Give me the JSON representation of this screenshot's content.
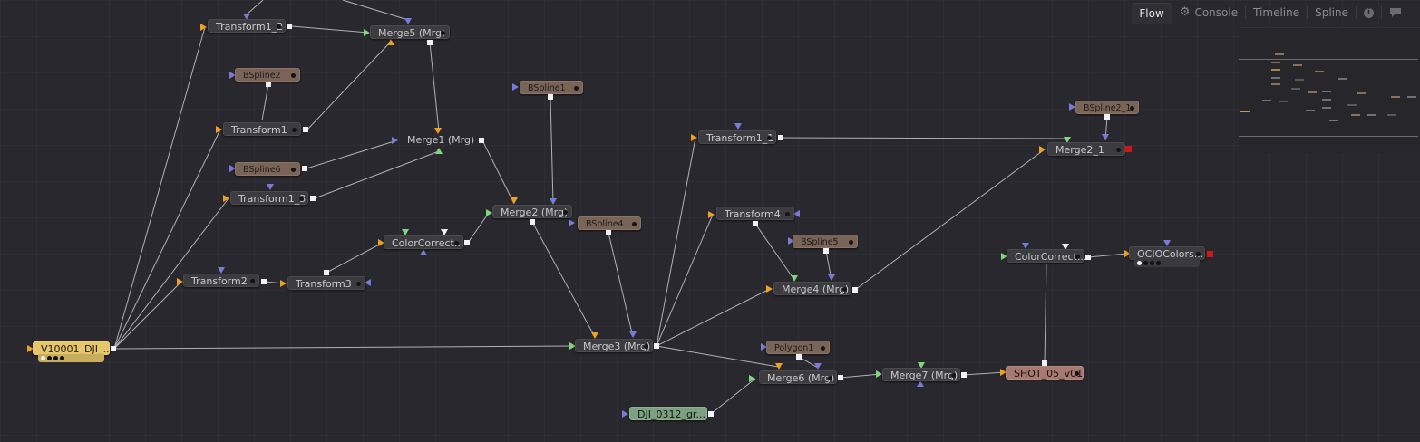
{
  "tabs": [
    {
      "label": "Flow",
      "active": true
    },
    {
      "label": "Console",
      "icon": "gear-icon"
    },
    {
      "label": "Timeline"
    },
    {
      "label": "Spline"
    },
    {
      "label": "",
      "icon": "info-icon"
    },
    {
      "label": "",
      "icon": "comment-icon"
    }
  ],
  "nodes": {
    "transform1_2": "Transform1_2",
    "merge5": "Merge5  (Mrg)",
    "bspline2": "BSpline2",
    "transform1": "Transform1",
    "merge1": "Merge1  (Mrg)",
    "bspline6": "BSpline6",
    "transform1_3": "Transform1_3",
    "bspline1": "BSpline1",
    "merge2": "Merge2  (Mrg)",
    "bspline4": "BSpline4",
    "colorcorrect1": "ColorCorrect...",
    "transform2": "Transform2",
    "transform3": "Transform3",
    "loader1": "V10001_DJI_...",
    "merge3": "Merge3  (Mrg)",
    "transform1_1": "Transform1_1",
    "transform4": "Transform4",
    "bspline5": "BSpline5",
    "merge4": "Merge4  (Mrg)",
    "polygon1": "Polygon1",
    "merge6": "Merge6  (Mrg)",
    "merge7": "Merge7  (Mrg)",
    "saver1": "SHOT_05_v01",
    "loader2": "DJI_0312_gr...",
    "bspline2_1": "BSpline2_1",
    "merge2_1": "Merge2_1",
    "colorcorrect2": "ColorCorrect...",
    "ocio": "OCIOColors..."
  },
  "colors": {
    "background": "#28282e",
    "wire": "#c8c8cc",
    "input_orange": "#f0a020",
    "input_green": "#7fd67f",
    "input_blue": "#7a7ad8"
  }
}
